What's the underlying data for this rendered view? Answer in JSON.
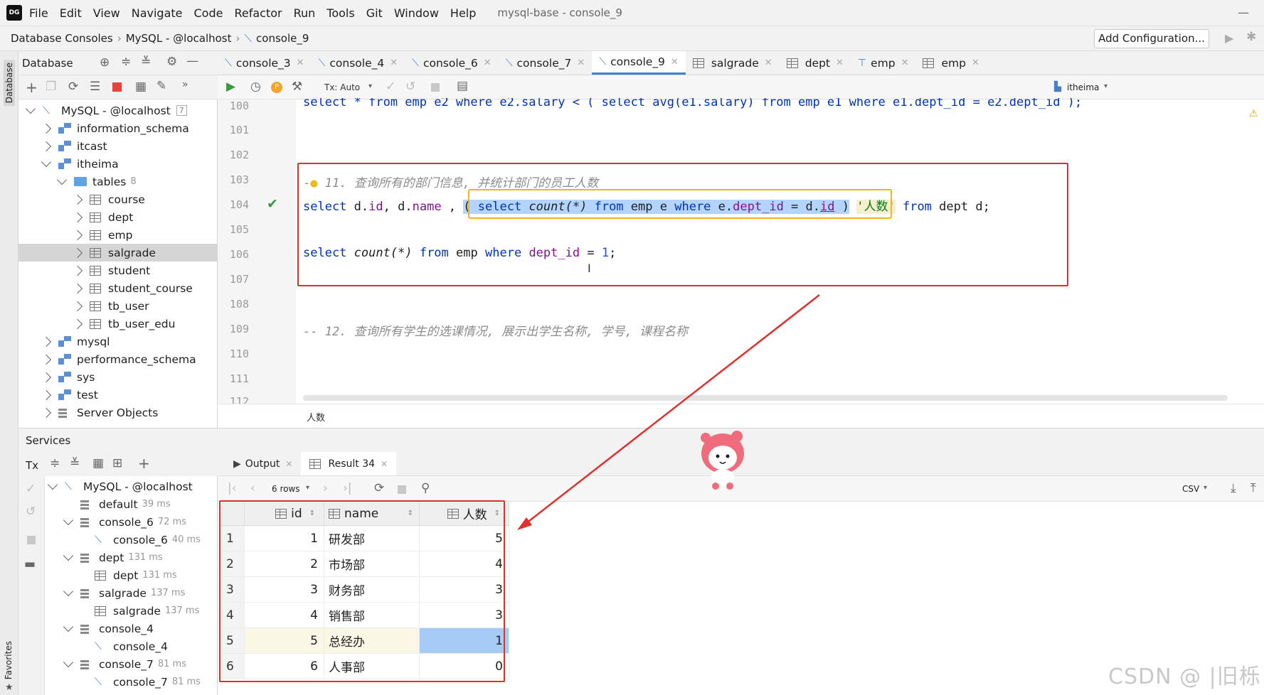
{
  "menu": {
    "items": [
      "File",
      "Edit",
      "View",
      "Navigate",
      "Code",
      "Refactor",
      "Run",
      "Tools",
      "Git",
      "Window",
      "Help"
    ],
    "title": "mysql-base - console_9"
  },
  "nav": {
    "crumbs": [
      "Database Consoles",
      "MySQL - @localhost",
      "console_9"
    ],
    "add_config": "Add Configuration..."
  },
  "db_panel": {
    "title": "Database",
    "side_label": "Database",
    "fav_label": "Favorites"
  },
  "tree": [
    {
      "label": "MySQL - @localhost",
      "badge": "7"
    },
    {
      "label": "information_schema"
    },
    {
      "label": "itcast"
    },
    {
      "label": "itheima"
    },
    {
      "label": "tables",
      "count": "8"
    },
    {
      "label": "course"
    },
    {
      "label": "dept"
    },
    {
      "label": "emp"
    },
    {
      "label": "salgrade"
    },
    {
      "label": "student"
    },
    {
      "label": "student_course"
    },
    {
      "label": "tb_user"
    },
    {
      "label": "tb_user_edu"
    },
    {
      "label": "mysql"
    },
    {
      "label": "performance_schema"
    },
    {
      "label": "sys"
    },
    {
      "label": "test"
    },
    {
      "label": "Server Objects"
    }
  ],
  "tabs": [
    "console_3",
    "console_4",
    "console_6",
    "console_7",
    "console_9",
    "salgrade",
    "dept",
    "emp",
    "emp"
  ],
  "editor_tools": {
    "tx": "Tx: Auto",
    "schema": "itheima"
  },
  "lines": {
    "l100": "100",
    "l101": "101",
    "l102": "102",
    "l103": "103",
    "l104": "104",
    "l105": "105",
    "l106": "106",
    "l107": "107",
    "l108": "108",
    "l109": "109",
    "l110": "110",
    "l111": "111",
    "l112": "112"
  },
  "code": {
    "l100": "select * from emp e2 where e2.salary < ( select avg(e1.salary) from emp e1 where e1.dept_id = e2.dept_id );",
    "c103": "11. 查询所有的部门信息, 并统计部门的员工人数",
    "c109": "-- 12. 查询所有学生的选课情况, 展示出学生名称, 学号, 课程名称",
    "t_select": "select",
    "t_d": "d.",
    "t_id": "id",
    "t_comma": ", ",
    "t_name": "name",
    "t_sep": " , ",
    "t_open": "( ",
    "t_count": "count",
    "t_star": "(*)",
    "t_from": "from",
    "t_emp": "emp e",
    "t_where": "where",
    "t_e": "e.",
    "t_deptid": "dept_id",
    "t_eq": " = ",
    "t_did": "id",
    "t_close": " )",
    "t_alias": "'人数'",
    "t_dept": "dept d;",
    "t_dept_id": "dept_id",
    "t_one": "1",
    "t_semi": ";",
    "t_emp2": "emp",
    "t_dash": "-"
  },
  "crumb_bottom": "人数",
  "services": {
    "title": "Services",
    "tx": "Tx"
  },
  "svtree": [
    {
      "label": "MySQL - @localhost",
      "t": ""
    },
    {
      "label": "default",
      "t": "39 ms"
    },
    {
      "label": "console_6",
      "t": "72 ms"
    },
    {
      "label": "console_6",
      "t": "40 ms"
    },
    {
      "label": "dept",
      "t": "131 ms"
    },
    {
      "label": "dept",
      "t": "131 ms"
    },
    {
      "label": "salgrade",
      "t": "137 ms"
    },
    {
      "label": "salgrade",
      "t": "137 ms"
    },
    {
      "label": "console_4",
      "t": ""
    },
    {
      "label": "console_4",
      "t": ""
    },
    {
      "label": "console_7",
      "t": "81 ms"
    },
    {
      "label": "console_7",
      "t": "81 ms"
    }
  ],
  "result_tabs": [
    "Output",
    "Result 34"
  ],
  "result_tools": {
    "rows": "6 rows",
    "format": "CSV"
  },
  "grid": {
    "headers": [
      "id",
      "name",
      "人数"
    ],
    "rows": [
      [
        "1",
        "1",
        "研发部",
        "5"
      ],
      [
        "2",
        "2",
        "市场部",
        "4"
      ],
      [
        "3",
        "3",
        "财务部",
        "3"
      ],
      [
        "4",
        "4",
        "销售部",
        "3"
      ],
      [
        "5",
        "5",
        "总经办",
        "1"
      ],
      [
        "6",
        "6",
        "人事部",
        "0"
      ]
    ]
  },
  "watermark": "CSDN @ |旧栎",
  "colors": {
    "accent": "#4083c9",
    "annotation": "#e0302e",
    "highlight": "#f5b324"
  }
}
